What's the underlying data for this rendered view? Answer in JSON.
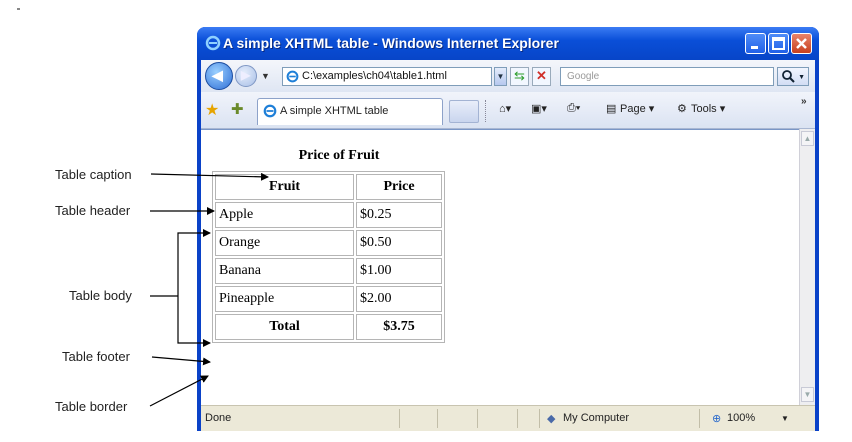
{
  "window": {
    "title": "A simple XHTML table - Windows Internet Explorer"
  },
  "navigation": {
    "address": "C:\\examples\\ch04\\table1.html",
    "search_placeholder": "Google"
  },
  "tabs": {
    "active_label": "A simple XHTML table"
  },
  "toolbar": {
    "page_label": "Page ▾",
    "tools_label": "Tools ▾"
  },
  "status": {
    "left_text": "Done",
    "zone": "My Computer",
    "zoom": "100%"
  },
  "table": {
    "caption": "Price of Fruit",
    "headers": [
      "Fruit",
      "Price"
    ],
    "rows": [
      [
        "Apple",
        "$0.25"
      ],
      [
        "Orange",
        "$0.50"
      ],
      [
        "Banana",
        "$1.00"
      ],
      [
        "Pineapple",
        "$2.00"
      ]
    ],
    "footer": [
      "Total",
      "$3.75"
    ]
  },
  "annotations": {
    "caption_label": "Table caption",
    "header_label": "Table header",
    "body_label": "Table body",
    "footer_label": "Table footer",
    "border_label": "Table border"
  },
  "colors": {
    "titlebar": "#0a4fd8",
    "close_button": "#c8401e"
  }
}
